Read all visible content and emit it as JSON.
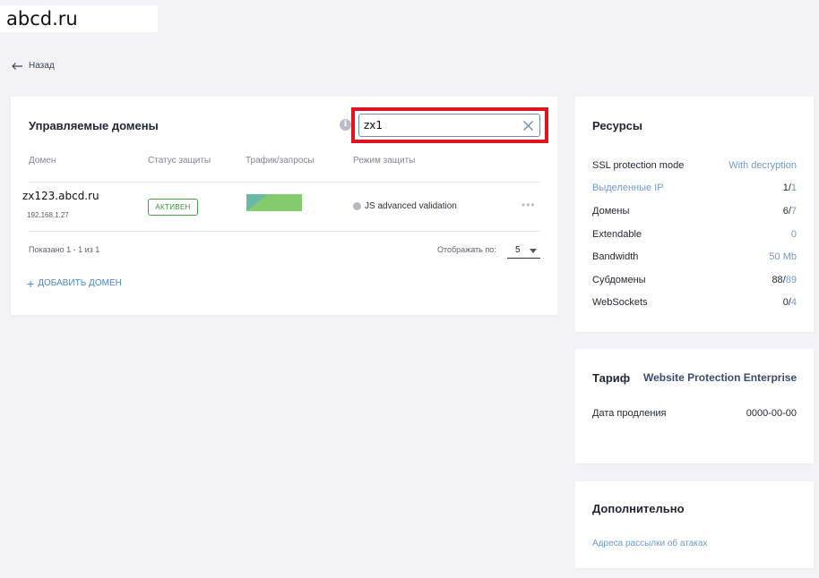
{
  "site": {
    "label": "abcd.ru"
  },
  "nav": {
    "back_label": "Назад"
  },
  "domains_card": {
    "title": "Управляемые домены",
    "search": {
      "value": "zx1",
      "placeholder": ""
    },
    "columns": [
      "Домен",
      "Статус защиты",
      "Трафик/запросы",
      "Режим защиты"
    ],
    "rows": [
      {
        "domain": "zx123.abcd.ru",
        "ip": "192.168.1.27",
        "status": "АКТИВЕН",
        "mode": "JS advanced validation"
      }
    ],
    "pagination": {
      "shown_text": "Показано 1 - 1 из 1",
      "per_page_label": "Отображать по:",
      "per_page_value": "5"
    },
    "add_domain_label": "ДОБАВИТЬ ДОМЕН"
  },
  "resources": {
    "title": "Ресурсы",
    "items": [
      {
        "label": "SSL protection mode",
        "value": "With decryption"
      },
      {
        "label": "Выделенные IP",
        "used": "1",
        "total": "1"
      },
      {
        "label": "Домены",
        "used": "6",
        "total": "7"
      },
      {
        "label": "Extendable",
        "value": "0"
      },
      {
        "label": "Bandwidth",
        "value": "50 Mb"
      },
      {
        "label": "Субдомены",
        "used": "88",
        "total": "89"
      },
      {
        "label": "WebSockets",
        "used": "0",
        "total": "4"
      }
    ]
  },
  "tariff": {
    "title": "Тариф",
    "name": "Website Protection Enterprise",
    "renewal_label": "Дата продления",
    "renewal_date": "0000-00-00"
  },
  "extra": {
    "title": "Дополнительно",
    "attack_mailing_link": "Адреса рассылки об атаках"
  },
  "colors": {
    "accent_link": "#6d9ad0",
    "status_active": "#3e8f3e",
    "highlight_frame": "#e0131f",
    "traffic_bar": "#82cc6e"
  }
}
